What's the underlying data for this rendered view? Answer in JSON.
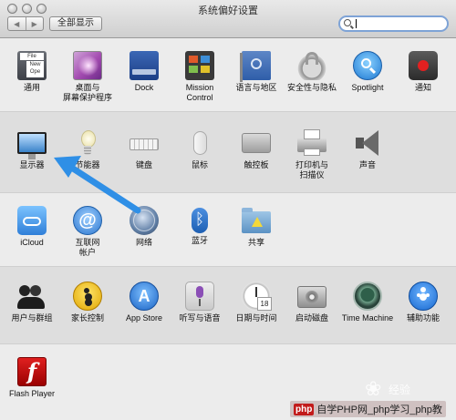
{
  "window": {
    "title": "系统偏好设置"
  },
  "toolbar": {
    "back": "◀",
    "forward": "▶",
    "show_all": "全部显示"
  },
  "search": {
    "value": ""
  },
  "row1": [
    {
      "label": "通用",
      "icon": "general-icon"
    },
    {
      "label": "桌面与\n屏幕保护程序",
      "icon": "desktop-screensaver-icon"
    },
    {
      "label": "Dock",
      "icon": "dock-icon"
    },
    {
      "label": "Mission\nControl",
      "icon": "mission-control-icon"
    },
    {
      "label": "语言与地区",
      "icon": "language-region-icon"
    },
    {
      "label": "安全性与隐私",
      "icon": "security-privacy-icon"
    },
    {
      "label": "Spotlight",
      "icon": "spotlight-icon"
    },
    {
      "label": "通知",
      "icon": "notifications-icon"
    }
  ],
  "row2": [
    {
      "label": "显示器",
      "icon": "displays-icon"
    },
    {
      "label": "节能器",
      "icon": "energy-saver-icon"
    },
    {
      "label": "键盘",
      "icon": "keyboard-icon"
    },
    {
      "label": "鼠标",
      "icon": "mouse-icon"
    },
    {
      "label": "触控板",
      "icon": "trackpad-icon"
    },
    {
      "label": "打印机与\n扫描仪",
      "icon": "printers-scanners-icon"
    },
    {
      "label": "声音",
      "icon": "sound-icon"
    }
  ],
  "row3": [
    {
      "label": "iCloud",
      "icon": "icloud-icon"
    },
    {
      "label": "互联网\n帐户",
      "icon": "internet-accounts-icon"
    },
    {
      "label": "网络",
      "icon": "network-icon"
    },
    {
      "label": "蓝牙",
      "icon": "bluetooth-icon"
    },
    {
      "label": "共享",
      "icon": "sharing-icon"
    }
  ],
  "row4": [
    {
      "label": "用户与群组",
      "icon": "users-groups-icon"
    },
    {
      "label": "家长控制",
      "icon": "parental-controls-icon"
    },
    {
      "label": "App Store",
      "icon": "app-store-icon"
    },
    {
      "label": "听写与语音",
      "icon": "dictation-speech-icon"
    },
    {
      "label": "日期与时间",
      "icon": "date-time-icon"
    },
    {
      "label": "启动磁盘",
      "icon": "startup-disk-icon"
    },
    {
      "label": "Time Machine",
      "icon": "time-machine-icon"
    },
    {
      "label": "辅助功能",
      "icon": "accessibility-icon"
    }
  ],
  "row5": [
    {
      "label": "Flash Player",
      "icon": "flash-player-icon"
    }
  ],
  "annotation": {
    "color": "#2f8fe6"
  },
  "watermark": {
    "text": "经验"
  },
  "footer": {
    "logo": "php",
    "text": "自学PHP网_php学习_php教"
  }
}
